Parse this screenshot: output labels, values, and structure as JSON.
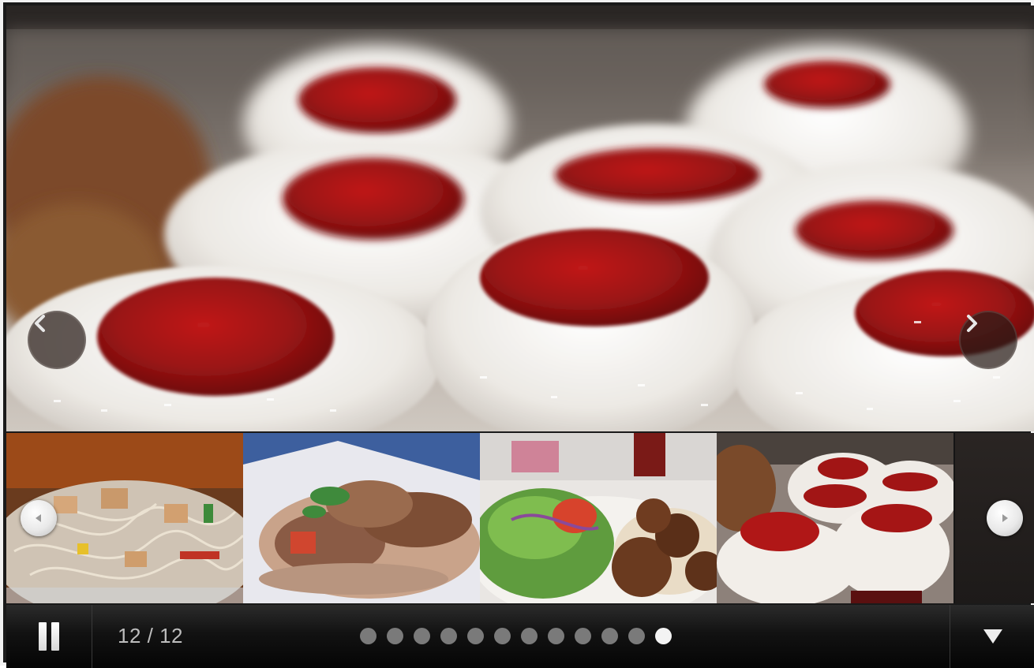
{
  "slideshow": {
    "counter": "12 / 12",
    "total_slides": 12,
    "current_slide": 12,
    "dots": [
      1,
      2,
      3,
      4,
      5,
      6,
      7,
      8,
      9,
      10,
      11,
      12
    ],
    "state": "playing"
  },
  "icons": {
    "main_prev": "chevron-left-icon",
    "main_next": "chevron-right-icon",
    "thumb_prev": "triangle-left-icon",
    "thumb_next": "triangle-right-icon",
    "pause": "pause-icon",
    "menu": "triangle-down-icon"
  },
  "colors": {
    "control_bar": "#0b0b0b",
    "dot_inactive": "#7a7a7a",
    "dot_active": "#f3f3f3",
    "counter_text": "#bdbdbd",
    "frosting_red": "#9b1414"
  }
}
